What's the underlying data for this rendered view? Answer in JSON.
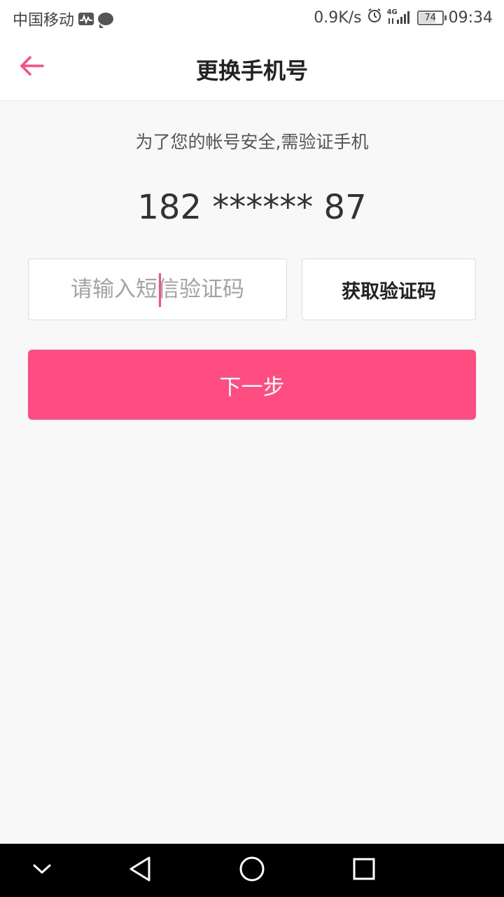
{
  "status_bar": {
    "carrier": "中国移动",
    "net_speed": "0.9K/s",
    "network": "4G",
    "battery": "74",
    "time": "09:34"
  },
  "header": {
    "title": "更换手机号",
    "back_icon": "arrow-left-icon",
    "accent_color": "#ff4d82"
  },
  "main": {
    "subtitle": "为了您的帐号安全,需验证手机",
    "phone_masked": "182 ****** 87",
    "code_input": {
      "placeholder": "请输入短信验证码",
      "value": ""
    },
    "get_code_label": "获取验证码",
    "next_label": "下一步"
  },
  "nav_bar": {
    "icons": [
      "chevron-down-icon",
      "back-triangle-icon",
      "home-circle-icon",
      "recents-square-icon"
    ]
  }
}
